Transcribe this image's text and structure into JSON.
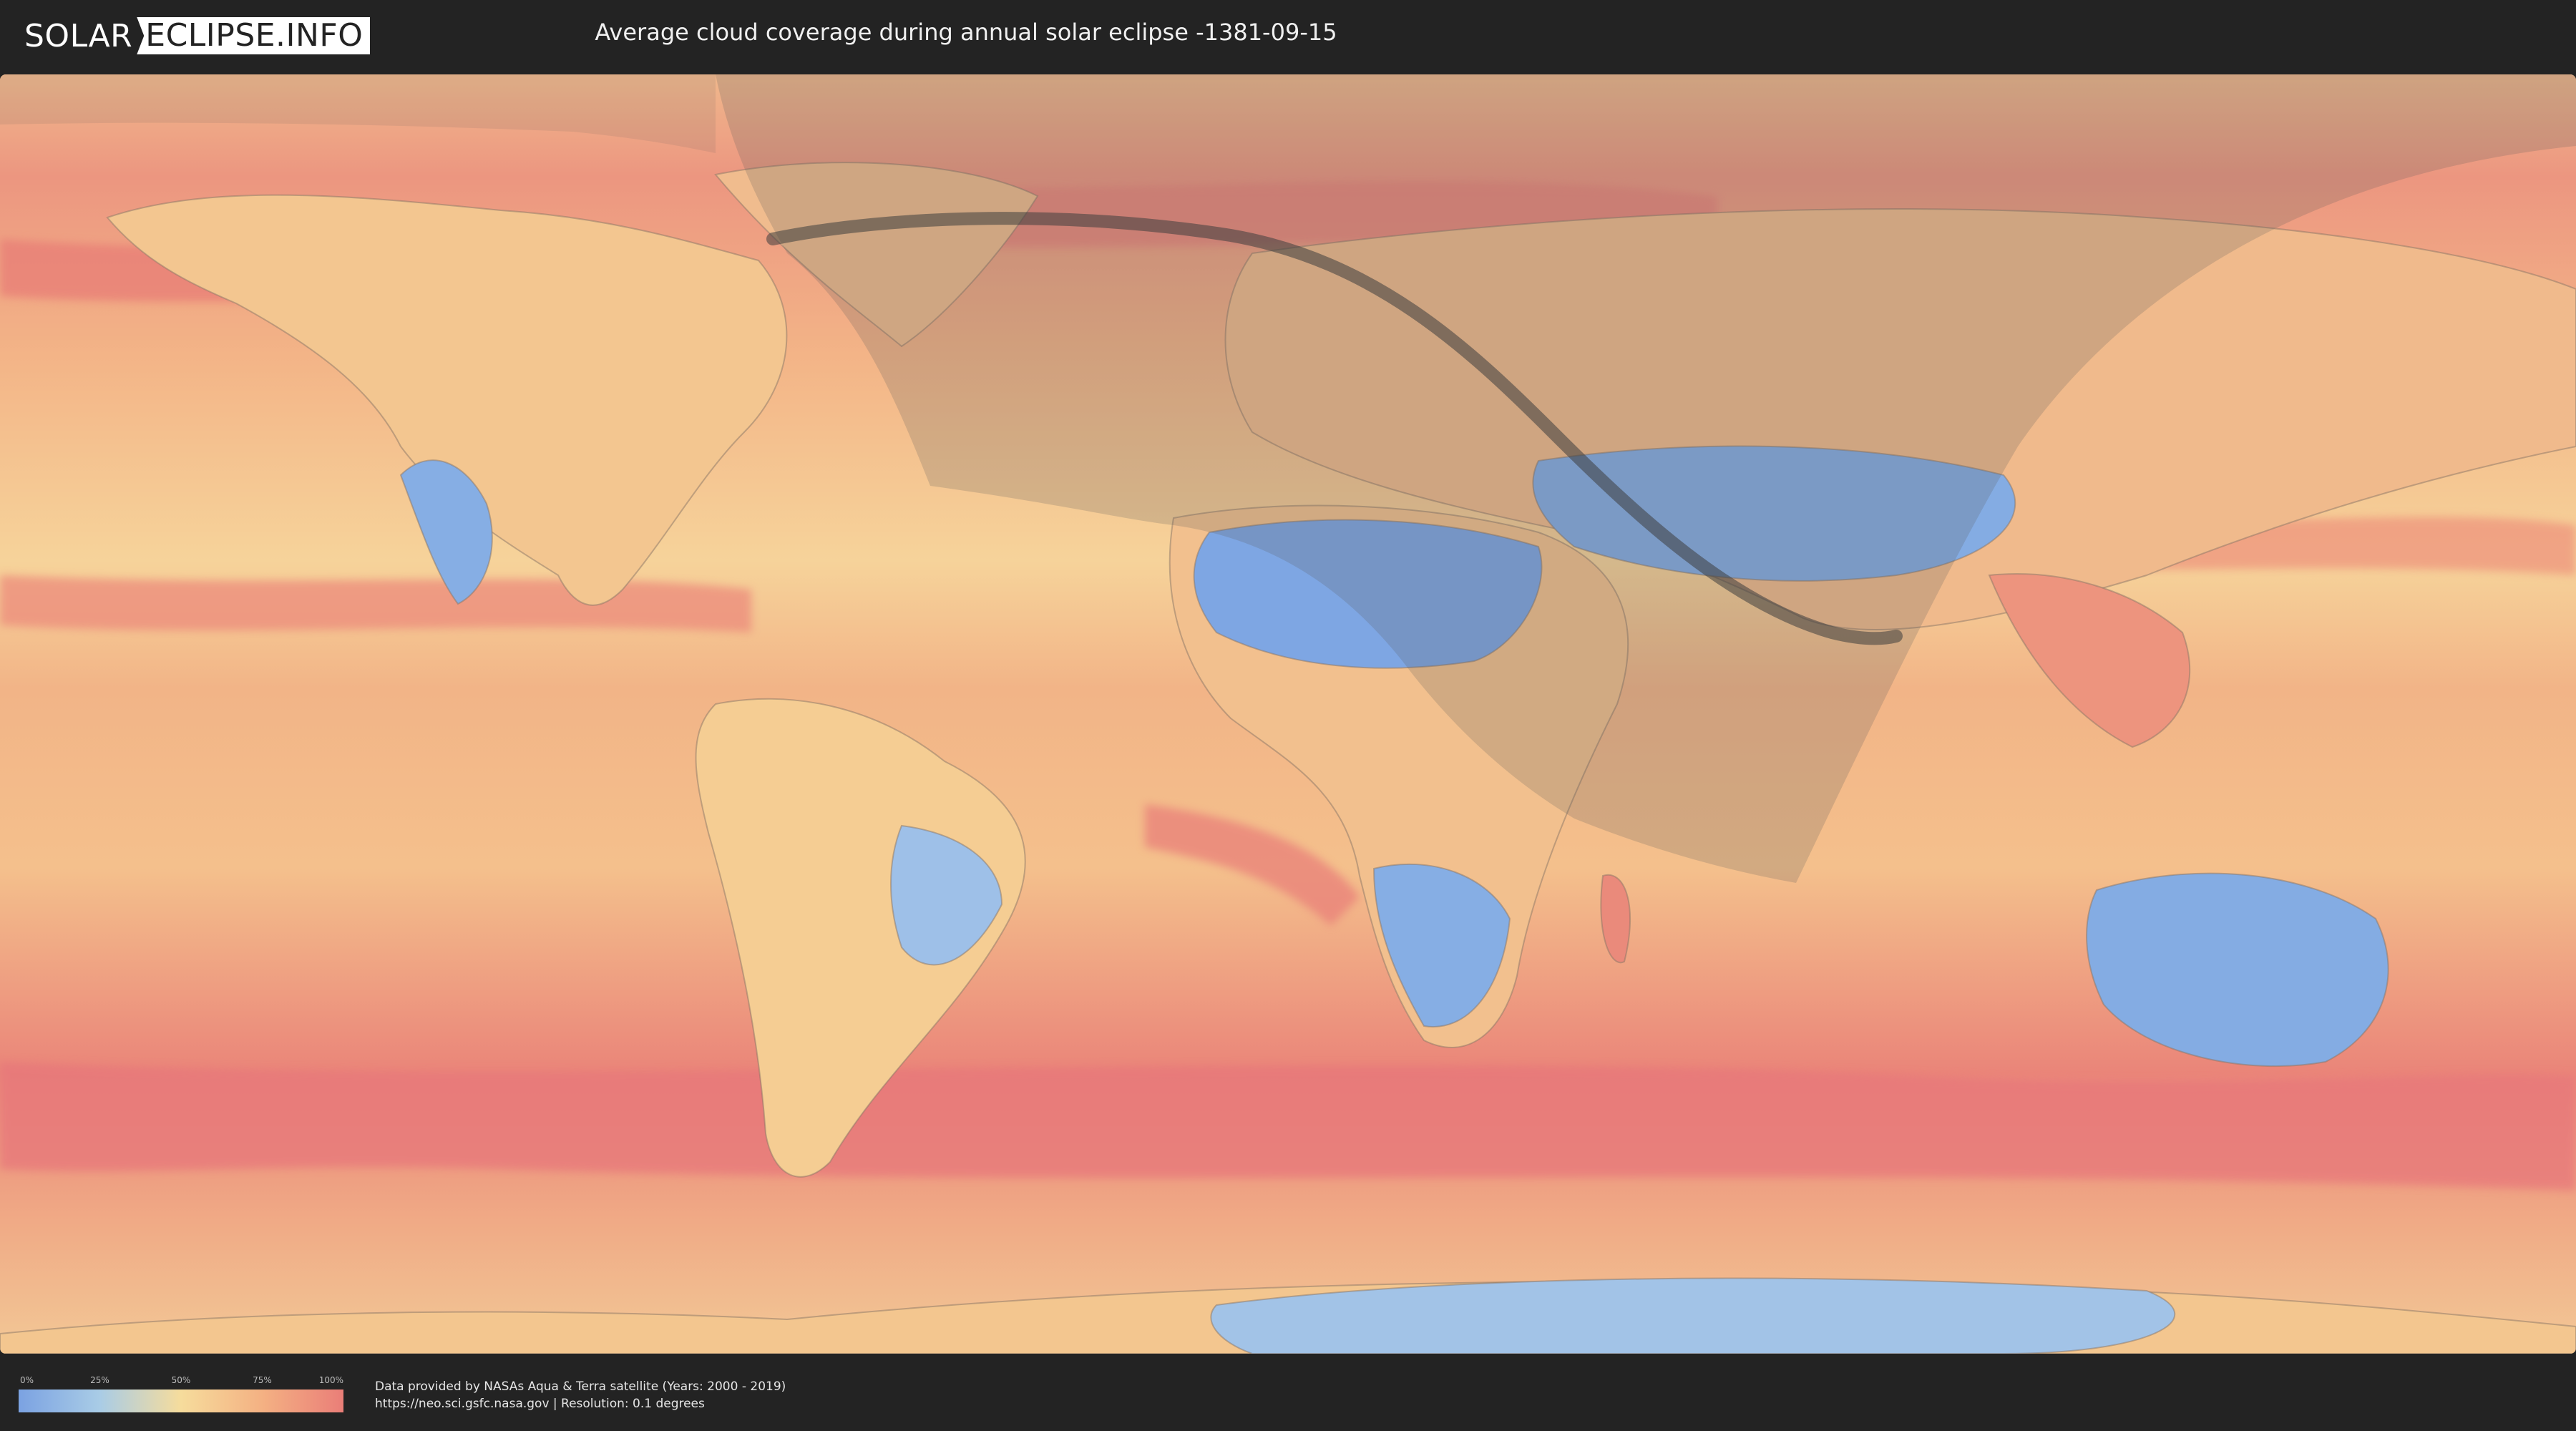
{
  "header": {
    "logo": {
      "left": "SOLAR",
      "right": "ECLIPSE.INFO"
    },
    "title": "Average cloud coverage during annual solar eclipse -1381-09-15"
  },
  "map": {
    "colors": {
      "ocean_wet": "#ea7e78",
      "mid": "#f4b183",
      "neutral": "#f6dc9c",
      "dry": "#a9cce6",
      "very_dry": "#7ba2e2",
      "eclipse_shade": "#5a5a5a",
      "centerline": "#3e3e3e"
    }
  },
  "legend": {
    "ticks": [
      "0%",
      "25%",
      "50%",
      "75%",
      "100%"
    ]
  },
  "credit": {
    "line1": "Data provided by NASAs Aqua & Terra satellite (Years: 2000 - 2019)",
    "line2": "https://neo.sci.gsfc.nasa.gov | Resolution: 0.1 degrees"
  }
}
